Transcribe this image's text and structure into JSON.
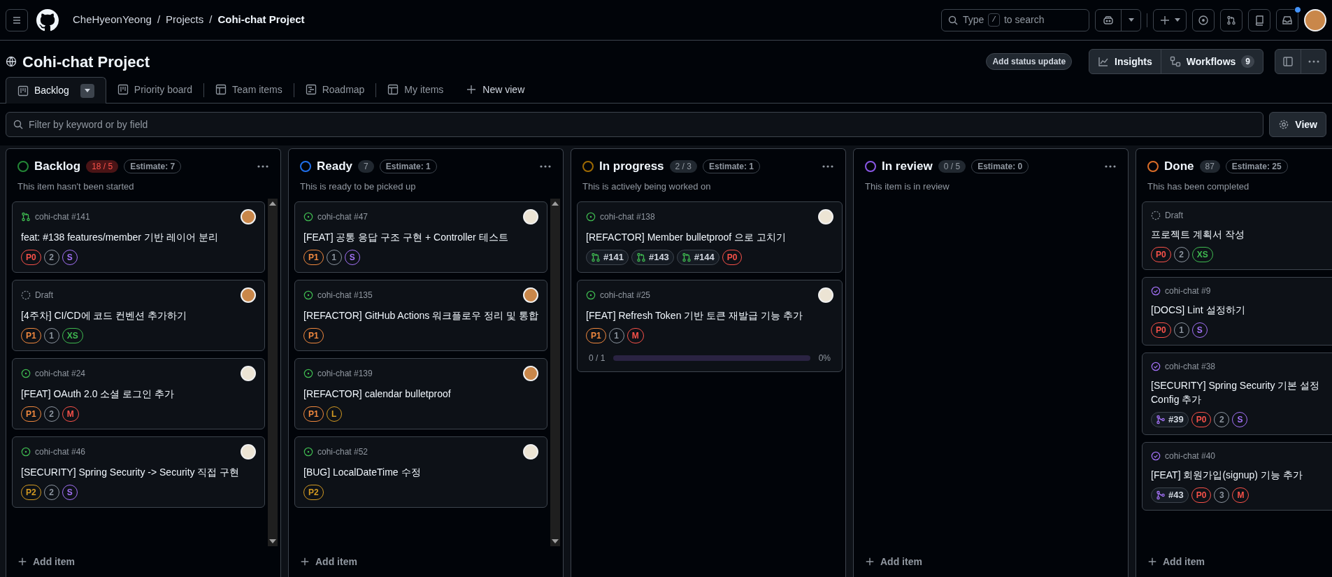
{
  "header": {
    "breadcrumbs": [
      {
        "text": "CheHyeonYeong",
        "current": false
      },
      {
        "text": "/",
        "current": false
      },
      {
        "text": "Projects",
        "current": false
      },
      {
        "text": "/",
        "current": false
      },
      {
        "text": "Cohi-chat Project",
        "current": true
      }
    ],
    "search": {
      "before": "Type",
      "key": "/",
      "after": "to search"
    },
    "inbox_unread": true
  },
  "project": {
    "title": "Cohi-chat Project",
    "status_button": "Add status update",
    "insights": "Insights",
    "workflows": "Workflows",
    "workflows_count": "9"
  },
  "tabs": [
    {
      "label": "Backlog",
      "kind": "board",
      "selected": true
    },
    {
      "label": "Priority board",
      "kind": "board",
      "selected": false
    },
    {
      "label": "Team items",
      "kind": "table",
      "selected": false
    },
    {
      "label": "Roadmap",
      "kind": "roadmap",
      "selected": false
    },
    {
      "label": "My items",
      "kind": "table",
      "selected": false
    }
  ],
  "new_view": "New view",
  "filter": {
    "placeholder": "Filter by keyword or by field"
  },
  "view_button": "View",
  "columns": [
    {
      "name": "Backlog",
      "color": "#238636",
      "count": "18 / 5",
      "over_limit": true,
      "estimate": "Estimate: 7",
      "description": "This item hasn't been started",
      "scrollbar": true,
      "add_item": "Add item",
      "cards": [
        {
          "kind": "pr-open",
          "ref": "cohi-chat #141",
          "title": "feat: #138 features/member 기반 레이어 분리",
          "avatar": {
            "color": "#c9874a"
          },
          "chips": [
            {
              "kind": "label",
              "text": "P0",
              "color": "#f85149"
            },
            {
              "kind": "label",
              "text": "2",
              "color": "#8b949e"
            },
            {
              "kind": "label",
              "text": "S",
              "color": "#a371f7"
            }
          ]
        },
        {
          "kind": "draft",
          "ref": "Draft",
          "title": "[4주차] CI/CD에 코드 컨벤션 추가하기",
          "avatar": {
            "color": "#c9874a"
          },
          "chips": [
            {
              "kind": "label",
              "text": "P1",
              "color": "#f0883e"
            },
            {
              "kind": "label",
              "text": "1",
              "color": "#8b949e"
            },
            {
              "kind": "label",
              "text": "XS",
              "color": "#3fb950"
            }
          ]
        },
        {
          "kind": "issue-open",
          "ref": "cohi-chat #24",
          "title": "[FEAT] OAuth 2.0 소셜 로그인 추가",
          "avatar": {
            "color": "#ece4d4"
          },
          "chips": [
            {
              "kind": "label",
              "text": "P1",
              "color": "#f0883e"
            },
            {
              "kind": "label",
              "text": "2",
              "color": "#8b949e"
            },
            {
              "kind": "label",
              "text": "M",
              "color": "#f85149"
            }
          ]
        },
        {
          "kind": "issue-open",
          "ref": "cohi-chat #46",
          "title": "[SECURITY] Spring Security -> Security 직접 구현",
          "avatar": {
            "color": "#ece4d4"
          },
          "chips": [
            {
              "kind": "label",
              "text": "P2",
              "color": "#d29922"
            },
            {
              "kind": "label",
              "text": "2",
              "color": "#8b949e"
            },
            {
              "kind": "label",
              "text": "S",
              "color": "#a371f7"
            }
          ]
        }
      ]
    },
    {
      "name": "Ready",
      "color": "#1f6feb",
      "count": "7",
      "over_limit": false,
      "estimate": "Estimate: 1",
      "description": "This is ready to be picked up",
      "scrollbar": true,
      "add_item": "Add item",
      "cards": [
        {
          "kind": "issue-open",
          "ref": "cohi-chat #47",
          "title": "[FEAT] 공통 응답 구조 구현 + Controller 테스트",
          "avatar": {
            "color": "#ece4d4"
          },
          "chips": [
            {
              "kind": "label",
              "text": "P1",
              "color": "#f0883e"
            },
            {
              "kind": "label",
              "text": "1",
              "color": "#8b949e"
            },
            {
              "kind": "label",
              "text": "S",
              "color": "#a371f7"
            }
          ]
        },
        {
          "kind": "issue-open",
          "ref": "cohi-chat #135",
          "title": "[REFACTOR] GitHub Actions 워크플로우 정리 및 통합",
          "avatar": {
            "color": "#c9874a"
          },
          "chips": [
            {
              "kind": "label",
              "text": "P1",
              "color": "#f0883e"
            }
          ]
        },
        {
          "kind": "issue-open",
          "ref": "cohi-chat #139",
          "title": "[REFACTOR] calendar bulletproof",
          "avatar": {
            "color": "#c9874a"
          },
          "chips": [
            {
              "kind": "label",
              "text": "P1",
              "color": "#f0883e"
            },
            {
              "kind": "label",
              "text": "L",
              "color": "#d29922"
            }
          ]
        },
        {
          "kind": "issue-open",
          "ref": "cohi-chat #52",
          "title": "[BUG] LocalDateTime 수정",
          "avatar": {
            "color": "#ece4d4"
          },
          "chips": [
            {
              "kind": "label",
              "text": "P2",
              "color": "#d29922"
            }
          ]
        }
      ]
    },
    {
      "name": "In progress",
      "color": "#9e6a03",
      "count": "2 / 3",
      "over_limit": false,
      "estimate": "Estimate: 1",
      "description": "This is actively being worked on",
      "scrollbar": false,
      "cards": [
        {
          "kind": "issue-open",
          "ref": "cohi-chat #138",
          "title": "[REFACTOR] Member bulletproof 으로 고치기",
          "avatar": {
            "color": "#ece4d4"
          },
          "chips": [
            {
              "kind": "pr",
              "text": "#141",
              "color": "#3fb950"
            },
            {
              "kind": "pr",
              "text": "#143",
              "color": "#3fb950"
            },
            {
              "kind": "pr",
              "text": "#144",
              "color": "#3fb950"
            },
            {
              "kind": "label",
              "text": "P0",
              "color": "#f85149"
            }
          ]
        },
        {
          "kind": "issue-open",
          "ref": "cohi-chat #25",
          "title": "[FEAT] Refresh Token 기반 토큰 재발급 기능 추가",
          "avatar": {
            "color": "#ece4d4"
          },
          "chips": [
            {
              "kind": "label",
              "text": "P1",
              "color": "#f0883e"
            },
            {
              "kind": "label",
              "text": "1",
              "color": "#8b949e"
            },
            {
              "kind": "label",
              "text": "M",
              "color": "#f85149"
            }
          ],
          "progress": {
            "reading": "0 / 1",
            "level": 0,
            "percent": "0%"
          }
        }
      ]
    },
    {
      "name": "In review",
      "color": "#8957e5",
      "count": "0 / 5",
      "over_limit": false,
      "estimate": "Estimate: 0",
      "description": "This item is in review",
      "scrollbar": false,
      "add_item": "Add item"
    },
    {
      "name": "Done",
      "color": "#db6d28",
      "count": "87",
      "over_limit": false,
      "estimate": "Estimate: 25",
      "description": "This has been completed",
      "scrollbar": false,
      "add_item": "Add item",
      "cards": [
        {
          "kind": "draft",
          "ref": "Draft",
          "title": "프로젝트 계획서 작성",
          "chips": [
            {
              "kind": "label",
              "text": "P0",
              "color": "#f85149"
            },
            {
              "kind": "label",
              "text": "2",
              "color": "#8b949e"
            },
            {
              "kind": "label",
              "text": "XS",
              "color": "#3fb950"
            }
          ]
        },
        {
          "kind": "issue-closed",
          "ref": "cohi-chat #9",
          "title": "[DOCS] Lint 설정하기",
          "chips": [
            {
              "kind": "label",
              "text": "P0",
              "color": "#f85149"
            },
            {
              "kind": "label",
              "text": "1",
              "color": "#8b949e"
            },
            {
              "kind": "label",
              "text": "S",
              "color": "#a371f7"
            }
          ]
        },
        {
          "kind": "issue-closed",
          "ref": "cohi-chat #38",
          "title": "[SECURITY] Spring Security 기본 설정 Config 추가",
          "chips": [
            {
              "kind": "merged",
              "text": "#39",
              "color": "#a371f7"
            },
            {
              "kind": "label",
              "text": "P0",
              "color": "#f85149"
            },
            {
              "kind": "label",
              "text": "2",
              "color": "#8b949e"
            },
            {
              "kind": "label",
              "text": "S",
              "color": "#a371f7"
            }
          ]
        },
        {
          "kind": "issue-closed",
          "ref": "cohi-chat #40",
          "title": "[FEAT] 회원가입(signup) 기능 추가",
          "chips": [
            {
              "kind": "merged",
              "text": "#43",
              "color": "#a371f7"
            },
            {
              "kind": "label",
              "text": "P0",
              "color": "#f85149"
            },
            {
              "kind": "label",
              "text": "3",
              "color": "#8b949e"
            },
            {
              "kind": "label",
              "text": "M",
              "color": "#f85149"
            }
          ]
        }
      ]
    }
  ]
}
